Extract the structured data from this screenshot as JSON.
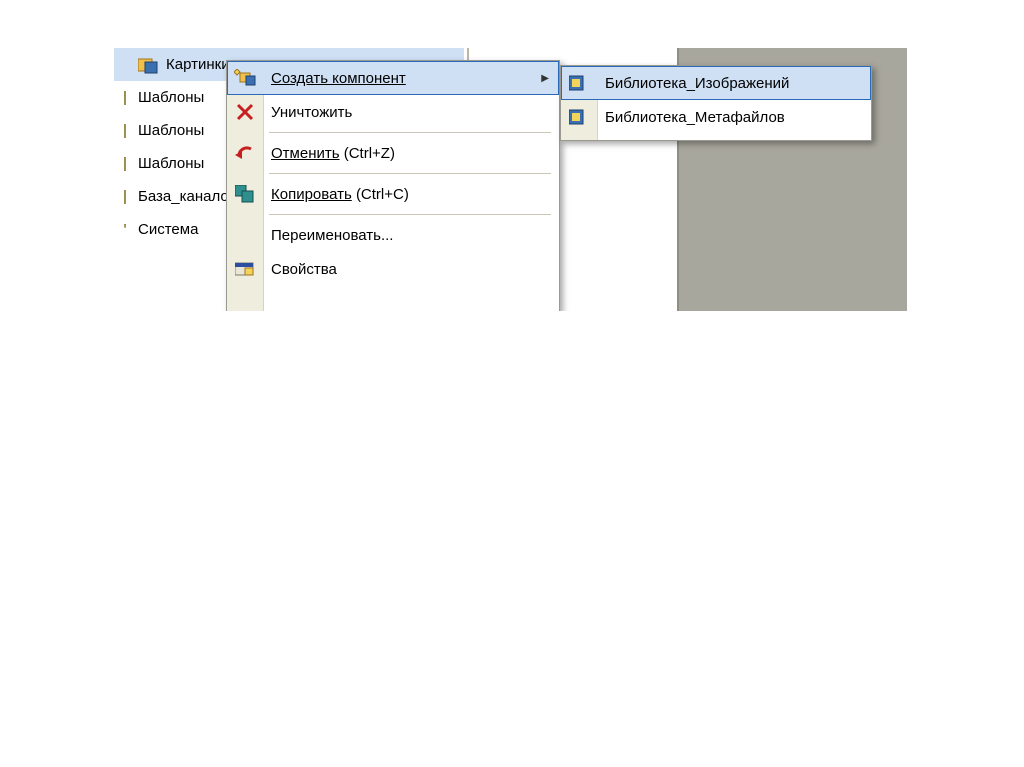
{
  "tree": {
    "items": [
      {
        "label": "Картинки",
        "selected": true,
        "mark": ""
      },
      {
        "label": "Шаблоны",
        "selected": false,
        "mark": "|"
      },
      {
        "label": "Шаблоны",
        "selected": false,
        "mark": "|"
      },
      {
        "label": "Шаблоны",
        "selected": false,
        "mark": "|"
      },
      {
        "label": "База_каналов",
        "selected": false,
        "mark": "|"
      },
      {
        "label": "Система",
        "selected": false,
        "mark": "'"
      }
    ]
  },
  "context_menu": {
    "items": [
      {
        "label": "Создать компонент",
        "has_submenu": true,
        "shortcut": "",
        "icon": "new-component-icon",
        "highlight": true
      },
      {
        "label": "Уничтожить",
        "has_submenu": false,
        "shortcut": "",
        "icon": "delete-icon"
      },
      {
        "sep": true
      },
      {
        "label": "Отменить",
        "has_submenu": false,
        "shortcut": "(Ctrl+Z)",
        "icon": "undo-icon",
        "underline_first": true
      },
      {
        "sep": true
      },
      {
        "label": "Копировать",
        "has_submenu": false,
        "shortcut": "(Ctrl+C)",
        "icon": "copy-icon",
        "underline_first": true
      },
      {
        "sep": true
      },
      {
        "label": "Переименовать...",
        "has_submenu": false,
        "shortcut": "",
        "icon": ""
      },
      {
        "label": "Свойства",
        "has_submenu": false,
        "shortcut": "",
        "icon": "properties-icon"
      }
    ]
  },
  "submenu": {
    "items": [
      {
        "label": "Библиотека_Изображений",
        "icon": "library-images-icon",
        "highlight": true
      },
      {
        "label": "Библиотека_Метафайлов",
        "icon": "library-metafiles-icon"
      }
    ]
  }
}
